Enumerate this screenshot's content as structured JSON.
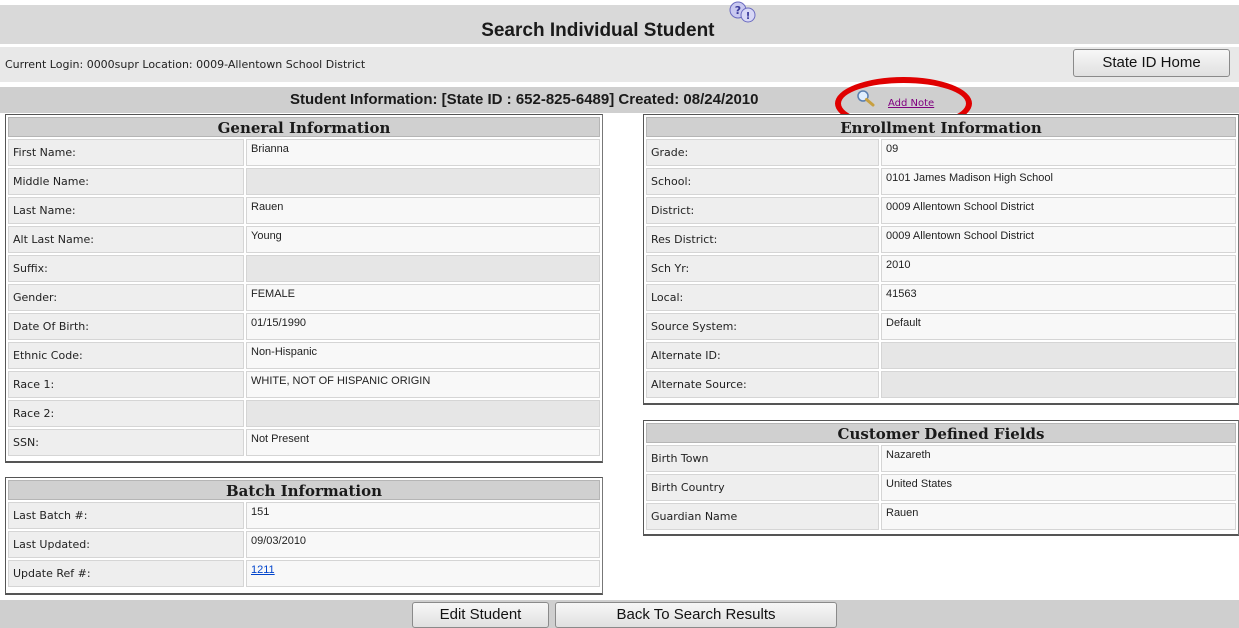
{
  "page": {
    "title": "Search Individual Student",
    "help_icon": "help-question-icon"
  },
  "login": {
    "text": "Current Login: 0000supr Location: 0009-Allentown School District",
    "state_id_home_label": "State ID Home"
  },
  "student_info": {
    "text": "Student Information: [State ID : 652-825-6489]   Created: 08/24/2010",
    "add_note_label": "Add Note",
    "add_note_icon": "magnifier-icon",
    "highlight_color": "#e00000"
  },
  "general": {
    "heading": "General Information",
    "rows": [
      {
        "label": "First Name:",
        "value": "Brianna"
      },
      {
        "label": "Middle Name:",
        "value": ""
      },
      {
        "label": "Last Name:",
        "value": "Rauen"
      },
      {
        "label": "Alt Last Name:",
        "value": "Young"
      },
      {
        "label": "Suffix:",
        "value": ""
      },
      {
        "label": "Gender:",
        "value": "FEMALE"
      },
      {
        "label": "Date Of Birth:",
        "value": "01/15/1990"
      },
      {
        "label": "Ethnic Code:",
        "value": "Non-Hispanic"
      },
      {
        "label": "Race 1:",
        "value": "WHITE, NOT OF HISPANIC ORIGIN"
      },
      {
        "label": "Race 2:",
        "value": ""
      },
      {
        "label": "SSN:",
        "value": "Not Present"
      }
    ]
  },
  "enrollment": {
    "heading": "Enrollment Information",
    "rows": [
      {
        "label": "Grade:",
        "value": "09"
      },
      {
        "label": "School:",
        "value": "0101 James Madison High School"
      },
      {
        "label": "District:",
        "value": "0009   Allentown School District"
      },
      {
        "label": "Res District:",
        "value": "0009   Allentown School District"
      },
      {
        "label": "Sch Yr:",
        "value": "2010"
      },
      {
        "label": "Local:",
        "value": "41563"
      },
      {
        "label": "Source System:",
        "value": "Default"
      },
      {
        "label": "Alternate ID:",
        "value": ""
      },
      {
        "label": "Alternate Source:",
        "value": ""
      }
    ]
  },
  "custom": {
    "heading": "Customer Defined Fields",
    "rows": [
      {
        "label": "Birth Town",
        "value": "Nazareth"
      },
      {
        "label": "Birth Country",
        "value": "United States"
      },
      {
        "label": "Guardian Name",
        "value": "Rauen"
      }
    ]
  },
  "batch": {
    "heading": "Batch Information",
    "rows": [
      {
        "label": "Last Batch #:",
        "value": "151"
      },
      {
        "label": "Last Updated:",
        "value": "09/03/2010"
      },
      {
        "label": "Update Ref #:",
        "value": "1211"
      }
    ]
  },
  "footer": {
    "edit_label": "Edit Student",
    "back_label": "Back To Search Results"
  }
}
